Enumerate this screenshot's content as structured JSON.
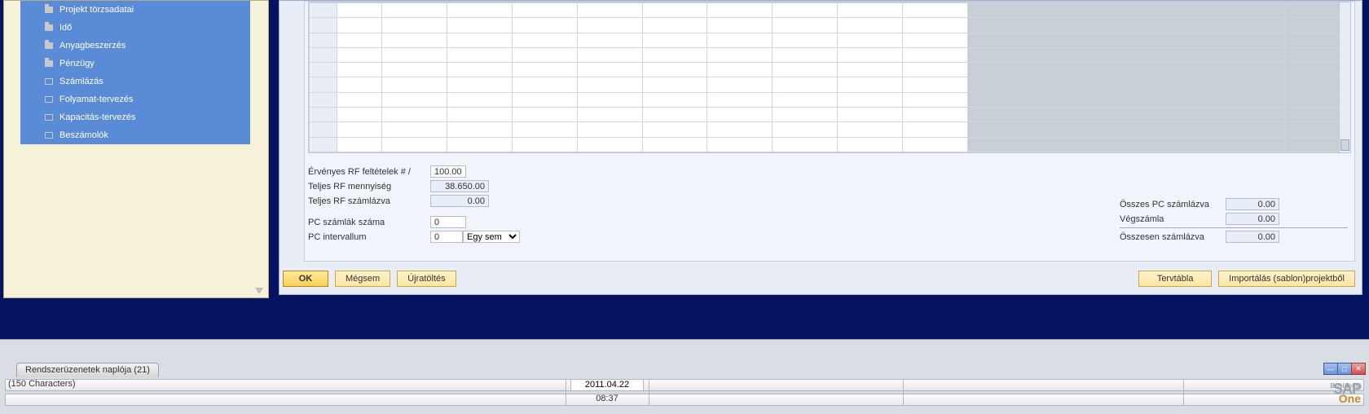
{
  "sidebar": {
    "items": [
      {
        "label": "Projekt törzsadatai",
        "icon": "folder"
      },
      {
        "label": "Idő",
        "icon": "folder"
      },
      {
        "label": "Anyagbeszerzés",
        "icon": "folder"
      },
      {
        "label": "Pénzügy",
        "icon": "folder"
      },
      {
        "label": "Számlázás",
        "icon": "form"
      },
      {
        "label": "Folyamat-tervezés",
        "icon": "form"
      },
      {
        "label": "Kapacitás-tervezés",
        "icon": "form"
      },
      {
        "label": "Beszámolók",
        "icon": "form"
      }
    ]
  },
  "fields": {
    "valid_rf_cond_label": "Érvényes RF feltételek # /",
    "valid_rf_cond_value": "100.000",
    "total_rf_qty_label": "Teljes RF mennyiség",
    "total_rf_qty_value": "38.650.00",
    "total_rf_billed_label": "Teljes RF számlázva",
    "total_rf_billed_value": "0.00",
    "pc_invoice_count_label": "PC számlák száma",
    "pc_invoice_count_value": "0",
    "pc_interval_label": "PC intervallum",
    "pc_interval_value": "0",
    "pc_interval_unit": "Egy sem",
    "sum_pc_billed_label": "Összes PC számlázva",
    "sum_pc_billed_value": "0.00",
    "final_invoice_label": "Végszámla",
    "final_invoice_value": "0.00",
    "total_billed_label": "Összesen számlázva",
    "total_billed_value": "0.00"
  },
  "buttons": {
    "ok": "OK",
    "cancel": "Mégsem",
    "reload": "Újratöltés",
    "plan_table": "Tervtábla",
    "import": "Importálás (sablon)projektből"
  },
  "bottom": {
    "tab_label": "Rendszerüzenetek naplója (21)",
    "row_text": "(150 Characters)",
    "date": "2011.04.22",
    "time": "08:37",
    "logo_main": "SAP",
    "logo_sub": "Business",
    "logo_one": "One"
  },
  "grid": {
    "cols": [
      36,
      58,
      84,
      84,
      84,
      84,
      84,
      84,
      84,
      84,
      84,
      410,
      84
    ],
    "tail_start": 11,
    "rows": 10
  }
}
